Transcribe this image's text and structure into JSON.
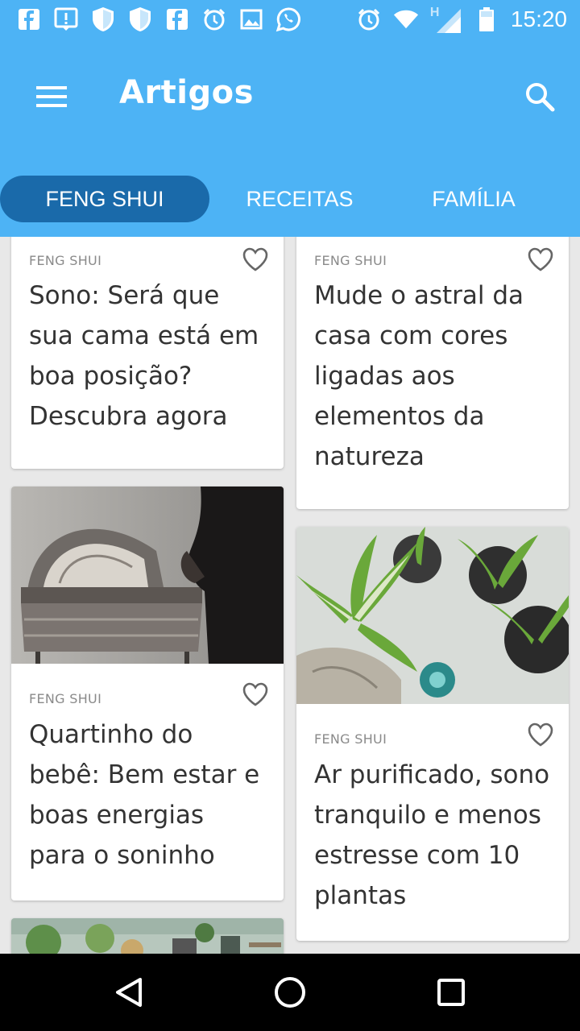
{
  "status_bar": {
    "time": "15:20",
    "network_label": "H",
    "icons": [
      "facebook-icon",
      "alert-icon",
      "shield-icon",
      "shield-icon",
      "facebook-icon",
      "alarm-icon",
      "image-icon",
      "whatsapp-icon",
      "alarm-icon",
      "wifi-icon",
      "signal-icon",
      "battery-icon"
    ]
  },
  "app_bar": {
    "title": "Artigos",
    "menu_icon": "hamburger-menu-icon",
    "search_icon": "search-icon"
  },
  "tabs": [
    {
      "label": "FENG SHUI",
      "active": true
    },
    {
      "label": "RECEITAS",
      "active": false
    },
    {
      "label": "FAMÍLIA",
      "active": false
    }
  ],
  "articles": [
    {
      "category": "FENG SHUI",
      "title": "Sono: Será que sua cama está em boa posição? Descubra agora",
      "has_image": false
    },
    {
      "category": "FENG SHUI",
      "title": "Mude o astral da casa com cores ligadas aos elementos da natureza",
      "has_image": false
    },
    {
      "category": "FENG SHUI",
      "title": "Quartinho do bebê: Bem estar e boas energias para o soninho",
      "has_image": true,
      "image": "baby-crib-photo"
    },
    {
      "category": "FENG SHUI",
      "title": "Ar purificado, sono tranquilo e menos estresse com 10 plantas",
      "has_image": true,
      "image": "plants-photo"
    },
    {
      "category": "",
      "title": "",
      "has_image": true,
      "image": "plants-shelf-photo"
    }
  ],
  "nav_bar": {
    "back_icon": "back-triangle-icon",
    "home_icon": "home-circle-icon",
    "recents_icon": "recents-square-icon"
  },
  "colors": {
    "primary": "#4db3f5",
    "active_tab": "#1a6aaa",
    "card_bg": "#ffffff",
    "page_bg": "#e8e8e8"
  }
}
